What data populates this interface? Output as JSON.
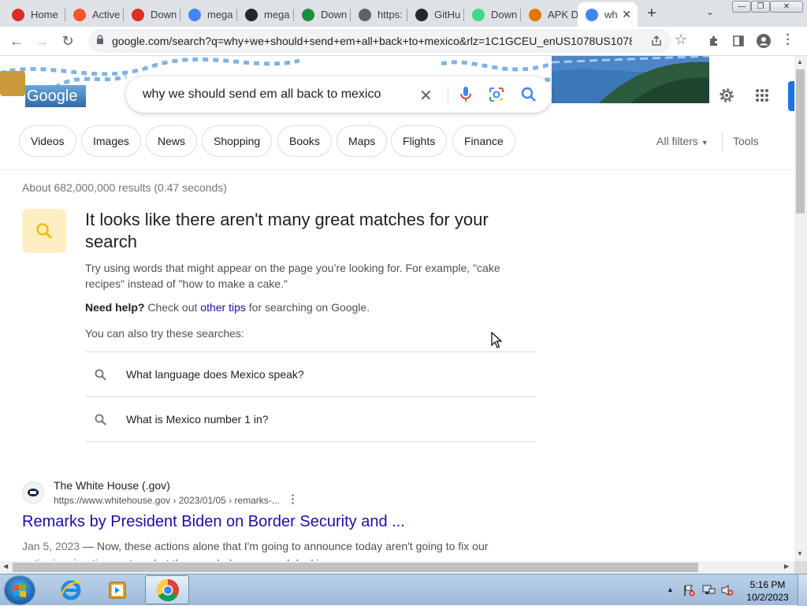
{
  "browser": {
    "tabs": [
      {
        "label": "Home",
        "icon": "gmail-icon",
        "color": "#d93025"
      },
      {
        "label": "Active",
        "icon": "brave-icon",
        "color": "#fb542b"
      },
      {
        "label": "Down",
        "icon": "gmail-icon",
        "color": "#d93025"
      },
      {
        "label": "mega",
        "icon": "google-icon",
        "color": "#4285f4"
      },
      {
        "label": "mega",
        "icon": "github-icon",
        "color": "#24292e"
      },
      {
        "label": "Down",
        "icon": "malwarebytes-icon",
        "color": "#1e8e3e"
      },
      {
        "label": "https:",
        "icon": "globe-icon",
        "color": "#5f6368"
      },
      {
        "label": "GitHu",
        "icon": "github-icon",
        "color": "#24292e"
      },
      {
        "label": "Down",
        "icon": "apk-icon",
        "color": "#3ddc84"
      },
      {
        "label": "APK D",
        "icon": "apk-icon",
        "color": "#e37400"
      },
      {
        "label": "wh",
        "icon": "google-icon",
        "color": "#4285f4",
        "active": true
      }
    ],
    "url": "google.com/search?q=why+we+should+send+em+all+back+to+mexico&rlz=1C1GCEU_enUS1078US1078..."
  },
  "search": {
    "logo_text": "Google",
    "query": "why we should send em all back to mexico",
    "chips": [
      "Videos",
      "Images",
      "News",
      "Shopping",
      "Books",
      "Maps",
      "Flights",
      "Finance"
    ],
    "all_filters": "All filters",
    "tools": "Tools",
    "stats": "About 682,000,000 results (0.47 seconds)"
  },
  "notice": {
    "title": "It looks like there aren't many great matches for your search",
    "tip": "Try using words that might appear on the page you’re looking for. For example, \"cake recipes\" instead of \"how to make a cake.\"",
    "help_bold": "Need help?",
    "help_pre": "Check out",
    "help_link": "other tips",
    "help_post": "for searching on Google.",
    "also_try": "You can also try these searches:",
    "suggestions": [
      "What language does Mexico speak?",
      "What is Mexico number 1 in?"
    ]
  },
  "result": {
    "site_name": "The White House (.gov)",
    "site_url": "https://www.whitehouse.gov › 2023/01/05 › remarks-...",
    "title": "Remarks by President Biden on Border Security and ...",
    "date": "Jan 5, 2023",
    "snippet": "— Now, these actions alone that I'm going to announce today aren't going to fix our entire immigration system, but they can help us a good deal in ..."
  },
  "taskbar": {
    "time": "5:16 PM",
    "date": "10/2/2023"
  },
  "colors": {
    "link": "#1a0dab",
    "google_blue": "#4285f4",
    "notice_bg": "#feefc3",
    "notice_icon": "#fbbc04"
  }
}
